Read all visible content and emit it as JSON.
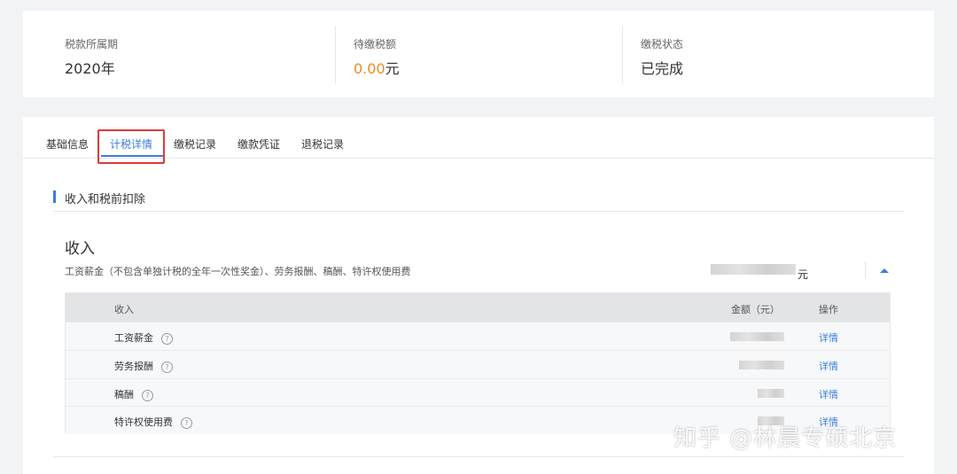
{
  "summary": {
    "period": {
      "label": "税款所属期",
      "value": "2020年"
    },
    "pending": {
      "label": "待缴税额",
      "amount": "0.00",
      "unit": "元"
    },
    "status": {
      "label": "缴税状态",
      "value": "已完成"
    }
  },
  "tabs": [
    {
      "label": "基础信息"
    },
    {
      "label": "计税详情",
      "active": true
    },
    {
      "label": "缴税记录"
    },
    {
      "label": "缴款凭证"
    },
    {
      "label": "退税记录"
    }
  ],
  "section": {
    "title": "收入和税前扣除"
  },
  "income": {
    "title": "收入",
    "description": "工资薪金（不包含单独计税的全年一次性奖金）、劳务报酬、稿酬、特许权使用费",
    "total_unit": "元"
  },
  "table": {
    "headers": {
      "income": "收入",
      "amount": "金额（元）",
      "action": "操作"
    },
    "rows": [
      {
        "name": "工资薪金",
        "action": "详情"
      },
      {
        "name": "劳务报酬",
        "action": "详情"
      },
      {
        "name": "稿酬",
        "action": "详情"
      },
      {
        "name": "特许权使用费",
        "action": "详情"
      }
    ]
  },
  "watermark": "知乎 @林晨专硕北京",
  "colors": {
    "accent": "#3b7ddd",
    "pending": "#f08a24",
    "complete": "#3dbb6a",
    "highlight": "#e03a3a"
  },
  "icons": {
    "help": "question-circle-icon",
    "collapse": "caret-up-icon"
  }
}
